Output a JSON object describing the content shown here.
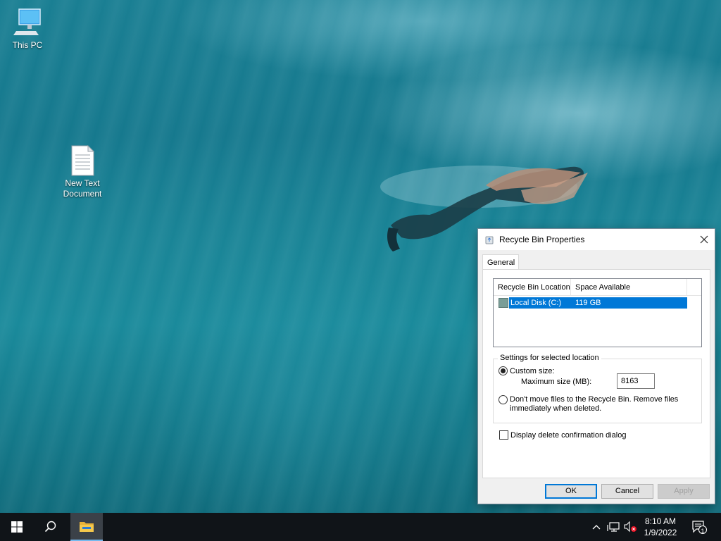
{
  "desktop": {
    "icons": [
      {
        "label": "This PC",
        "icon": "computer-monitor-icon"
      },
      {
        "label": "New Text Document",
        "icon": "text-document-icon"
      }
    ]
  },
  "dialog": {
    "title": "Recycle Bin Properties",
    "tab": "General",
    "columns": [
      "Recycle Bin Location",
      "Space Available"
    ],
    "rows": [
      {
        "location": "Local Disk (C:)",
        "space": "119 GB",
        "selected": true
      }
    ],
    "settings_group_label": "Settings for selected location",
    "custom_size_label": "Custom size:",
    "custom_size_selected": true,
    "max_size_label": "Maximum size (MB):",
    "max_size_value": "8163",
    "dont_move_label_line1": "Don't move files to the Recycle Bin. Remove files",
    "dont_move_label_line2": "immediately when deleted.",
    "dont_move_selected": false,
    "confirm_label": "Display delete confirmation dialog",
    "confirm_checked": false,
    "ok_label": "OK",
    "cancel_label": "Cancel",
    "apply_label": "Apply",
    "apply_enabled": false
  },
  "taskbar": {
    "items": [
      "windows-start-icon",
      "search-icon",
      "file-explorer-icon"
    ],
    "tray": [
      "chevron-up-icon",
      "network-icon",
      "volume-muted-icon"
    ],
    "time": "8:10 AM",
    "date": "1/9/2022",
    "notification_count": "1"
  },
  "colors": {
    "accent": "#0078d7",
    "taskbar": "#101418"
  }
}
